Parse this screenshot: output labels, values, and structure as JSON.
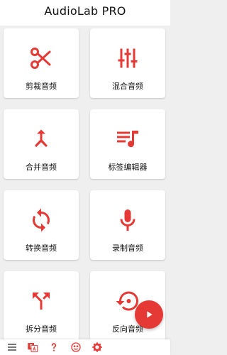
{
  "app": {
    "title": "AudioLab PRO"
  },
  "colors": {
    "accent": "#e53935",
    "background": "#efefef",
    "card": "#ffffff"
  },
  "tiles": [
    {
      "label": "剪裁音频",
      "icon": "scissors-icon"
    },
    {
      "label": "混合音频",
      "icon": "mixer-sliders-icon"
    },
    {
      "label": "合并音频",
      "icon": "merge-arrows-icon"
    },
    {
      "label": "标签编辑器",
      "icon": "playlist-music-icon"
    },
    {
      "label": "转换音频",
      "icon": "convert-cycle-icon"
    },
    {
      "label": "录制音频",
      "icon": "microphone-icon"
    },
    {
      "label": "拆分音频",
      "icon": "split-arrows-icon"
    },
    {
      "label": "反向音频",
      "icon": "reverse-history-icon"
    }
  ],
  "bottom_bar": {
    "items": [
      {
        "icon": "menu-icon"
      },
      {
        "icon": "translate-icon"
      },
      {
        "icon": "help-icon"
      },
      {
        "icon": "brain-icon"
      },
      {
        "icon": "gear-icon"
      }
    ]
  },
  "fab": {
    "icon": "play-icon"
  }
}
